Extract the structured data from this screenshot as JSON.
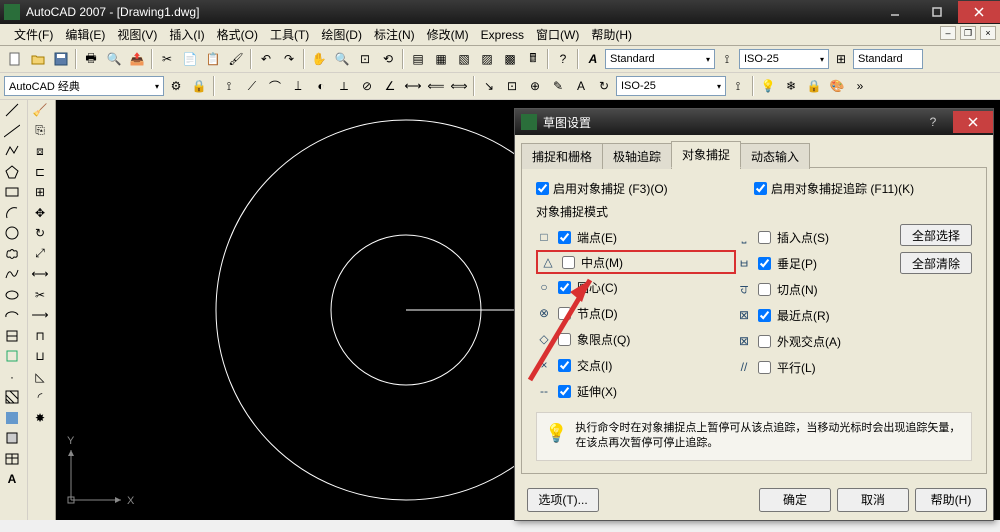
{
  "app": {
    "title": "AutoCAD 2007 - [Drawing1.dwg]"
  },
  "menu": {
    "items": [
      "文件(F)",
      "编辑(E)",
      "视图(V)",
      "插入(I)",
      "格式(O)",
      "工具(T)",
      "绘图(D)",
      "标注(N)",
      "修改(M)",
      "Express",
      "窗口(W)",
      "帮助(H)"
    ]
  },
  "toolbar1": {
    "workspace": "AutoCAD 经典"
  },
  "styles": {
    "text_style": "Standard",
    "dim_style": "ISO-25",
    "dim_style2": "Standard",
    "table_style": "ISO-25"
  },
  "ucs": {
    "x": "X",
    "y": "Y"
  },
  "dialog": {
    "title": "草图设置",
    "tabs": [
      "捕捉和栅格",
      "极轴追踪",
      "对象捕捉",
      "动态输入"
    ],
    "active_tab": 2,
    "osnap_on_label": "启用对象捕捉 (F3)(O)",
    "otrack_on_label": "启用对象捕捉追踪 (F11)(K)",
    "modes_title": "对象捕捉模式",
    "modes_left": [
      {
        "g": "□",
        "label": "端点(E)",
        "c": true
      },
      {
        "g": "△",
        "label": "中点(M)",
        "c": false,
        "hl": true
      },
      {
        "g": "○",
        "label": "圆心(C)",
        "c": true
      },
      {
        "g": "⊗",
        "label": "节点(D)",
        "c": false
      },
      {
        "g": "◇",
        "label": "象限点(Q)",
        "c": false
      },
      {
        "g": "×",
        "label": "交点(I)",
        "c": true
      },
      {
        "g": "--",
        "label": "延伸(X)",
        "c": true
      }
    ],
    "modes_right": [
      {
        "g": "⎵",
        "label": "插入点(S)",
        "c": false
      },
      {
        "g": "ㅂ",
        "label": "垂足(P)",
        "c": true
      },
      {
        "g": "ਹ",
        "label": "切点(N)",
        "c": false
      },
      {
        "g": "⊠",
        "label": "最近点(R)",
        "c": true
      },
      {
        "g": "⊠",
        "label": "外观交点(A)",
        "c": false
      },
      {
        "g": "//",
        "label": "平行(L)",
        "c": false
      }
    ],
    "select_all": "全部选择",
    "clear_all": "全部清除",
    "hint": "执行命令时在对象捕捉点上暂停可从该点追踪，当移动光标时会出现追踪矢量，在该点再次暂停可停止追踪。",
    "options": "选项(T)...",
    "ok": "确定",
    "cancel": "取消",
    "help": "帮助(H)"
  }
}
